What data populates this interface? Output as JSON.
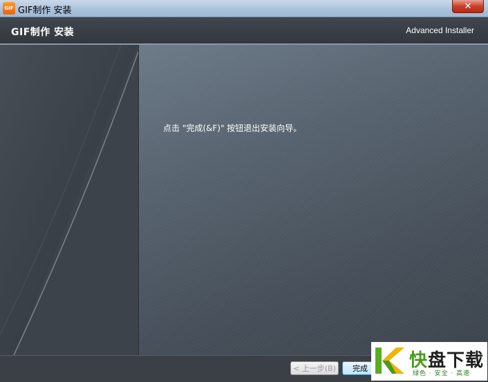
{
  "window": {
    "title": "GIF制作 安装",
    "icon_label": "GIF",
    "close_label": "✕"
  },
  "header": {
    "title": "GIF制作 安装",
    "brand": "Advanced Installer"
  },
  "main": {
    "message": "点击 \"完成(&F)\" 按钮退出安装向导。"
  },
  "footer": {
    "back_label": "< 上一步(B)",
    "finish_label": "完成"
  },
  "watermark": {
    "logo_char": "快",
    "name_rest": "盘下载",
    "slogan": "绿色 · 安全 · 高速"
  },
  "colors": {
    "header_bg": "#3a4047",
    "panel_bg": "#56626e",
    "watermark_green": "#4a9b1d"
  }
}
